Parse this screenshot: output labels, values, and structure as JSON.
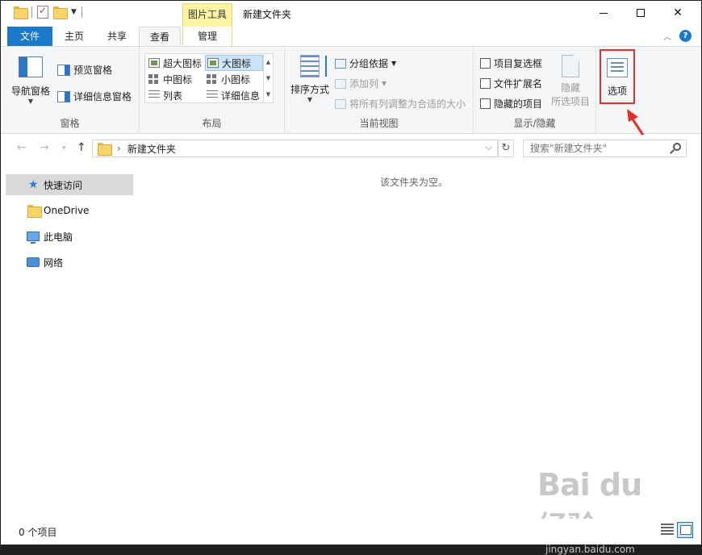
{
  "window": {
    "title": "新建文件夹",
    "context_tab": "图片工具",
    "buttons": {
      "minimize": "minimize",
      "maximize": "maximize",
      "close": "✕"
    }
  },
  "tabs": {
    "file": "文件",
    "home": "主页",
    "share": "共享",
    "view": "查看",
    "manage": "管理"
  },
  "ribbon": {
    "pane": {
      "label": "窗格",
      "nav_pane": "导航窗格",
      "preview_pane": "预览窗格",
      "details_pane": "详细信息窗格"
    },
    "layout": {
      "label": "布局",
      "items": [
        "超大图标",
        "大图标",
        "中图标",
        "小图标",
        "列表",
        "详细信息"
      ],
      "selected": "大图标"
    },
    "current_view": {
      "label": "当前视图",
      "sort_by": "排序方式",
      "group_by": "分组依据",
      "add_column": "添加列",
      "size_all_columns": "将所有列调整为合适的大小"
    },
    "show_hide": {
      "label": "显示/隐藏",
      "item_checkboxes": "项目复选框",
      "file_extensions": "文件扩展名",
      "hidden_items": "隐藏的项目",
      "hide_selected_1": "隐藏",
      "hide_selected_2": "所选项目"
    },
    "options": {
      "label": "选项"
    }
  },
  "address": {
    "path": "新建文件夹",
    "search_placeholder": "搜索\"新建文件夹\""
  },
  "sidebar": {
    "items": [
      {
        "label": "快速访问",
        "icon": "star-icon",
        "selected": true
      },
      {
        "label": "OneDrive",
        "icon": "folder-icon"
      },
      {
        "label": "此电脑",
        "icon": "computer-icon"
      },
      {
        "label": "网络",
        "icon": "network-icon"
      }
    ]
  },
  "main": {
    "empty_message": "该文件夹为空。"
  },
  "status": {
    "item_count": "0 个项目"
  },
  "watermark": {
    "main": "Bai du 经验",
    "sub": "jingyan.baidu.com"
  },
  "colors": {
    "file_tab": "#1979ca",
    "context_tab": "#fdf3a5",
    "highlight": "#e0302a"
  }
}
